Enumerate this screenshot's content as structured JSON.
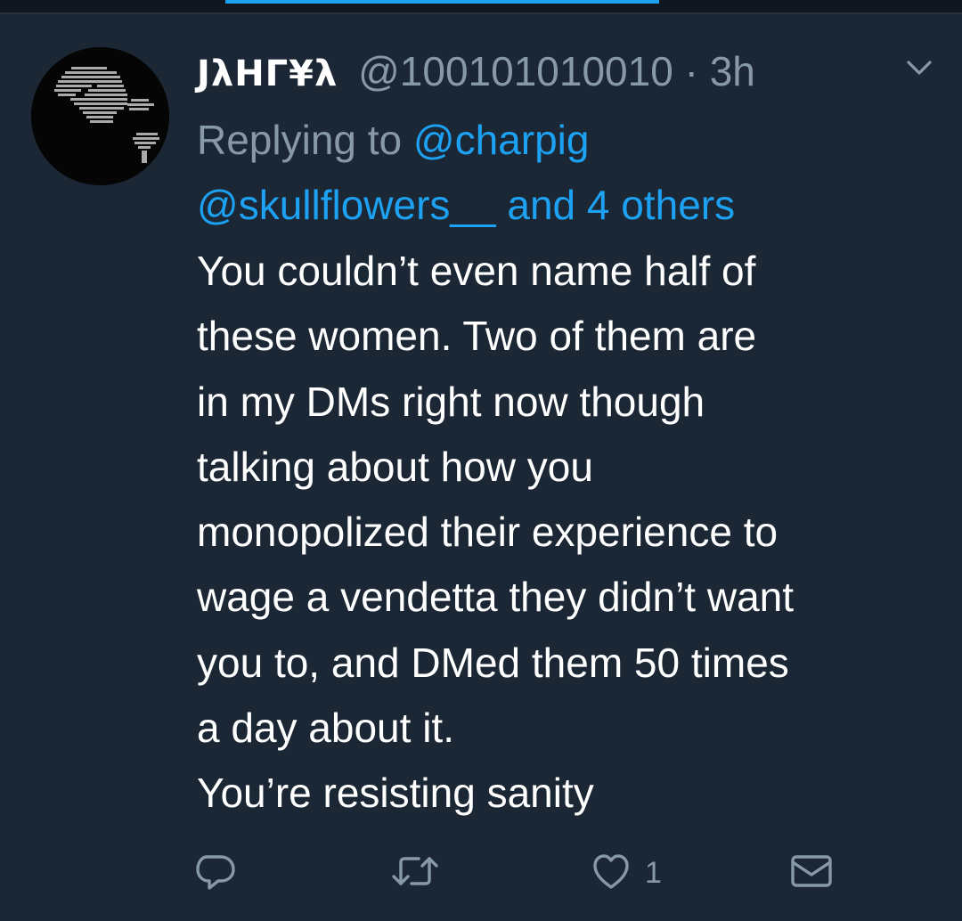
{
  "tweet": {
    "display_name": "JλHГ¥λ",
    "handle": "@100101010010",
    "separator": "·",
    "time": "3h",
    "reply_prefix": "Replying to",
    "reply_to_1": "@charpig",
    "reply_to_2": "@skullflowers__",
    "reply_others": "and 4 others",
    "text_lines": [
      "You couldn’t even name half of",
      "these women. Two of them are",
      "in my DMs right now though",
      "talking about how you",
      "monopolized their experience to",
      "wage a vendetta they didn’t want",
      "you to, and DMed them 50 times",
      "a day about it.",
      "You’re resisting sanity"
    ]
  },
  "actions": {
    "reply_icon": "reply-icon",
    "retweet_icon": "retweet-icon",
    "like_icon": "heart-icon",
    "like_count": "1",
    "dm_icon": "envelope-icon"
  },
  "colors": {
    "background": "#1b2735",
    "link": "#1da1f2",
    "muted": "#8899a6",
    "text": "#ffffff"
  }
}
